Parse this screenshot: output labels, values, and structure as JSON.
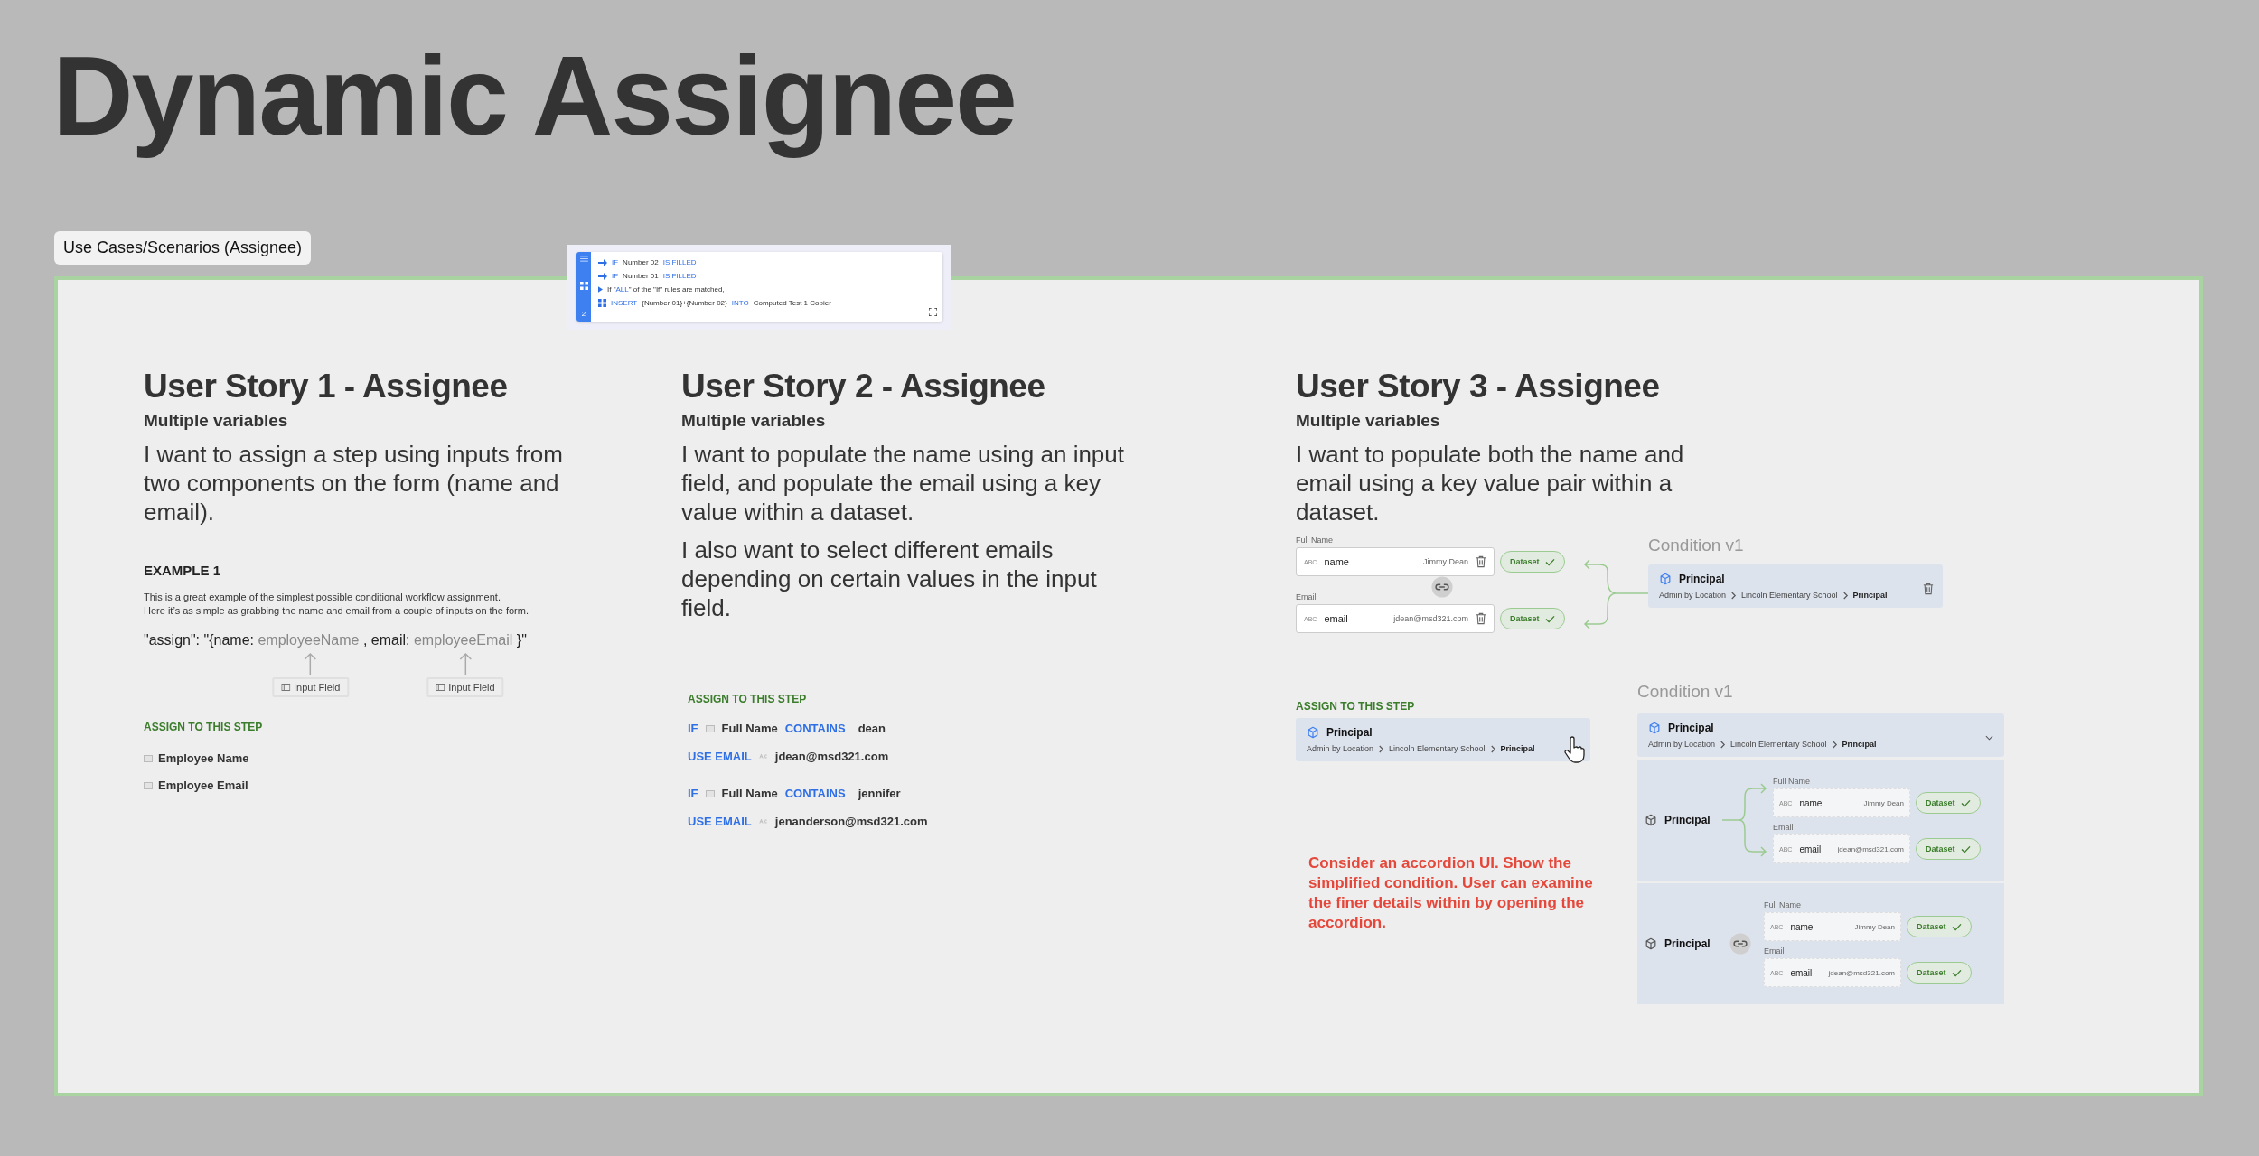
{
  "title": "Dynamic Assignee",
  "section_tag": "Use Cases/Scenarios (Assignee)",
  "rule_card": {
    "step_number": "2",
    "rows": [
      {
        "kind": "condition",
        "tokens": [
          {
            "text": "IF",
            "accent": true
          },
          {
            "text": "Number 02",
            "accent": false
          },
          {
            "text": "IS FILLED",
            "accent": true
          }
        ]
      },
      {
        "kind": "condition",
        "tokens": [
          {
            "text": "IF",
            "accent": true
          },
          {
            "text": "Number 01",
            "accent": false
          },
          {
            "text": "IS FILLED",
            "accent": true
          }
        ]
      },
      {
        "kind": "summary",
        "tokens": [
          {
            "text": "If \"",
            "accent": false
          },
          {
            "text": "ALL",
            "accent": true
          },
          {
            "text": "\" of the \"If\" rules are matched,",
            "accent": false
          }
        ]
      },
      {
        "kind": "action",
        "tokens": [
          {
            "text": "INSERT",
            "accent": true
          },
          {
            "text": "{Number 01}+{Number 02}",
            "accent": false
          },
          {
            "text": "INTO",
            "accent": true
          },
          {
            "text": "Computed Test 1 Copier",
            "accent": false
          }
        ]
      }
    ]
  },
  "story1": {
    "heading": "User Story 1 - Assignee",
    "subtitle": "Multiple variables",
    "body": [
      "I want to assign a step using inputs from two components on the form (name and email)."
    ],
    "example": {
      "title": "EXAMPLE 1",
      "description": [
        "This is a great example of the simplest possible conditional workflow assignment.",
        "Here it’s as simple as grabbing the name and email from a couple of inputs on the form."
      ],
      "code": [
        {
          "text": "\"assign\": \"{name: ",
          "muted": false
        },
        {
          "text": "employeeName",
          "muted": true,
          "pointer": "Input Field"
        },
        {
          "text": ", email: ",
          "muted": false
        },
        {
          "text": "employeeEmail",
          "muted": true,
          "pointer": "Input Field"
        },
        {
          "text": "}\"",
          "muted": false
        }
      ]
    },
    "assign_label": "ASSIGN TO THIS STEP",
    "assignees": [
      "Employee Name",
      "Employee Email"
    ]
  },
  "story2": {
    "heading": "User Story 2 - Assignee",
    "subtitle": "Multiple variables",
    "body": [
      "I want to populate the name using an input field, and populate the email using a key value within a dataset.",
      "I also want to select different emails depending on certain values in the input field."
    ],
    "assign_label": "ASSIGN TO THIS STEP",
    "rules": [
      {
        "if": "IF",
        "field": "Full Name",
        "op": "CONTAINS",
        "value": "dean",
        "use": "USE EMAIL",
        "email": "jdean@msd321.com"
      },
      {
        "if": "IF",
        "field": "Full Name",
        "op": "CONTAINS",
        "value": "jennifer",
        "use": "USE EMAIL",
        "email": "jenanderson@msd321.com"
      }
    ]
  },
  "story3": {
    "heading": "User Story 3 - Assignee",
    "subtitle": "Multiple variables",
    "body": [
      "I want to populate both the name and email using a key value pair within a dataset."
    ],
    "fields": [
      {
        "label": "Full Name",
        "type": "ABC",
        "name": "name",
        "value": "Jimmy Dean",
        "badge": "Dataset"
      },
      {
        "label": "Email",
        "type": "ABC",
        "name": "email",
        "value": "jdean@msd321.com",
        "badge": "Dataset"
      }
    ],
    "condition": {
      "heading": "Condition v1",
      "title": "Principal",
      "path": [
        "Admin by Location",
        "Lincoln Elementary School",
        "Principal"
      ]
    },
    "assign_label": "ASSIGN TO THIS STEP",
    "collapsed": {
      "title": "Principal",
      "path": [
        "Admin by Location",
        "Lincoln Elementary School",
        "Principal"
      ]
    },
    "note": "Consider an accordion UI. Show the simplified condition. User can examine the finer details within by opening the accordion.",
    "accordion": {
      "heading": "Condition v1",
      "title": "Principal",
      "path": [
        "Admin by Location",
        "Lincoln Elementary School",
        "Principal"
      ],
      "expanded": true,
      "groups": [
        {
          "kind": "branch",
          "title": "Principal",
          "fields": [
            {
              "label": "Full Name",
              "type": "ABC",
              "name": "name",
              "value": "Jimmy Dean",
              "badge": "Dataset"
            },
            {
              "label": "Email",
              "type": "ABC",
              "name": "email",
              "value": "jdean@msd321.com",
              "badge": "Dataset"
            }
          ]
        },
        {
          "kind": "linked",
          "title": "Principal",
          "fields": [
            {
              "label": "Full Name",
              "type": "ABC",
              "name": "name",
              "value": "Jimmy Dean",
              "badge": "Dataset"
            },
            {
              "label": "Email",
              "type": "ABC",
              "name": "email",
              "value": "jdean@msd321.com",
              "badge": "Dataset"
            }
          ]
        }
      ]
    }
  }
}
